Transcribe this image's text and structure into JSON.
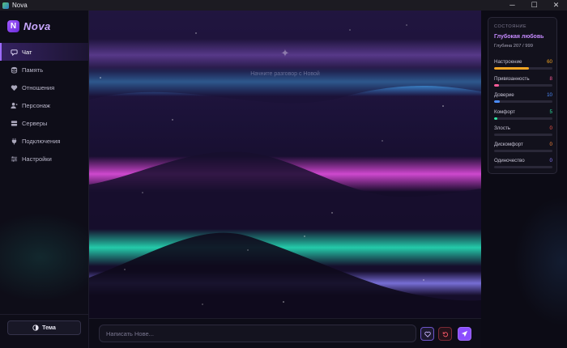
{
  "window": {
    "title": "Nova",
    "minimize": "─",
    "maximize": "☐",
    "close": "✕"
  },
  "brand": {
    "badge": "N",
    "name": "Nova"
  },
  "nav": [
    {
      "label": "Чат",
      "icon": "chat-bubble-icon",
      "active": true
    },
    {
      "label": "Память",
      "icon": "database-icon",
      "active": false
    },
    {
      "label": "Отношения",
      "icon": "heart-icon",
      "active": false
    },
    {
      "label": "Персонаж",
      "icon": "person-icon",
      "active": false
    },
    {
      "label": "Серверы",
      "icon": "server-icon",
      "active": false
    },
    {
      "label": "Подключения",
      "icon": "plug-icon",
      "active": false
    },
    {
      "label": "Настройки",
      "icon": "sliders-icon",
      "active": false
    }
  ],
  "sidebar": {
    "theme_button": "Тема"
  },
  "chat": {
    "empty_icon": "✦",
    "empty_text": "Начните разговор с Новой",
    "input_placeholder": "Написать Нове...",
    "heart_button_icon": "heart-icon",
    "reset_button_icon": "reset-icon",
    "send_button_icon": "send-icon"
  },
  "state": {
    "heading": "Состояние",
    "relationship": "Глубокая любовь",
    "depth_label": "Глубина 207 / 999",
    "stats": [
      {
        "label": "Настроение",
        "value": "60",
        "fraction": 0.6,
        "color": "#f5a623"
      },
      {
        "label": "Привязанность",
        "value": "8",
        "fraction": 0.08,
        "color": "#ff5c9a"
      },
      {
        "label": "Доверие",
        "value": "10",
        "fraction": 0.1,
        "color": "#4c8dff"
      },
      {
        "label": "Комфорт",
        "value": "5",
        "fraction": 0.05,
        "color": "#2ee6a0"
      },
      {
        "label": "Злость",
        "value": "0",
        "fraction": 0.0,
        "color": "#ff5a4a"
      },
      {
        "label": "Дискомфорт",
        "value": "0",
        "fraction": 0.0,
        "color": "#ff8a3d"
      },
      {
        "label": "Одиночество",
        "value": "0",
        "fraction": 0.0,
        "color": "#8a7dff"
      }
    ]
  },
  "colors": {
    "accent": "#8b4dff",
    "brand": "#c9a8ff",
    "relationship": "#c78bff"
  }
}
